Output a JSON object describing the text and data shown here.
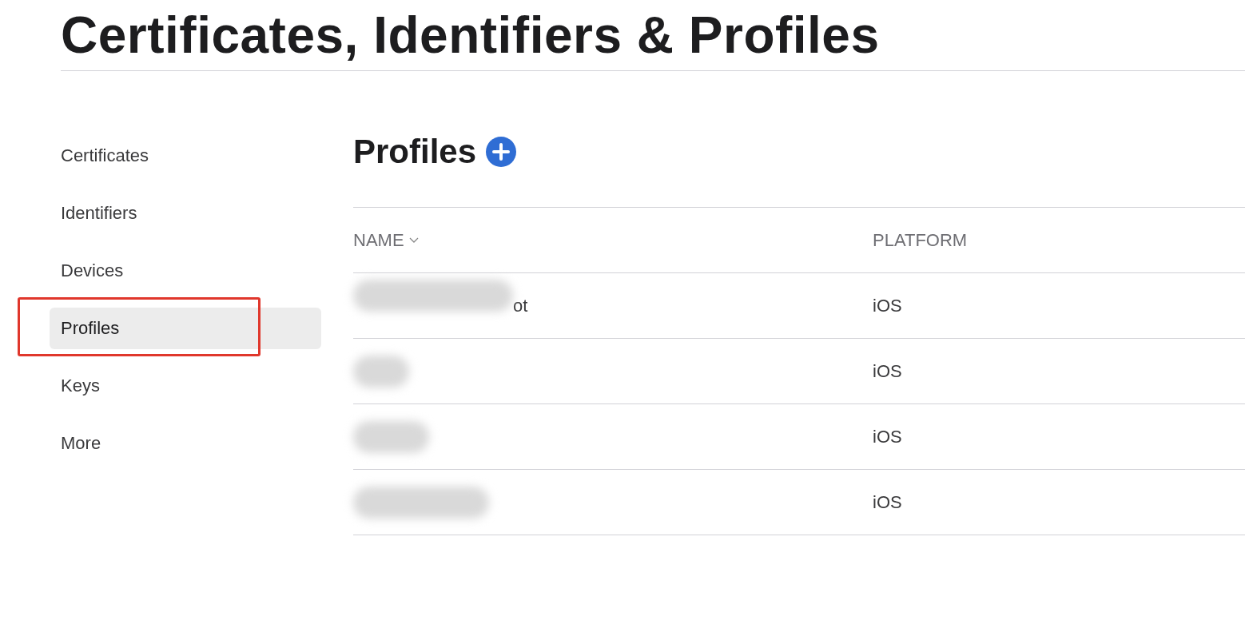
{
  "title": "Certificates, Identifiers & Profiles",
  "sidebar": {
    "items": [
      {
        "label": "Certificates",
        "selected": false,
        "annotated": false
      },
      {
        "label": "Identifiers",
        "selected": false,
        "annotated": false
      },
      {
        "label": "Devices",
        "selected": false,
        "annotated": false
      },
      {
        "label": "Profiles",
        "selected": true,
        "annotated": true
      },
      {
        "label": "Keys",
        "selected": false,
        "annotated": false
      },
      {
        "label": "More",
        "selected": false,
        "annotated": false
      }
    ]
  },
  "main": {
    "heading": "Profiles",
    "table": {
      "columns": [
        {
          "label": "NAME",
          "sorted": true
        },
        {
          "label": "PLATFORM",
          "sorted": false
        }
      ],
      "rows": [
        {
          "name": "ot",
          "redacted": true,
          "platform": "iOS"
        },
        {
          "redacted": true,
          "platform": "iOS"
        },
        {
          "redacted": true,
          "platform": "iOS"
        },
        {
          "redacted": true,
          "platform": "iOS"
        }
      ]
    }
  }
}
